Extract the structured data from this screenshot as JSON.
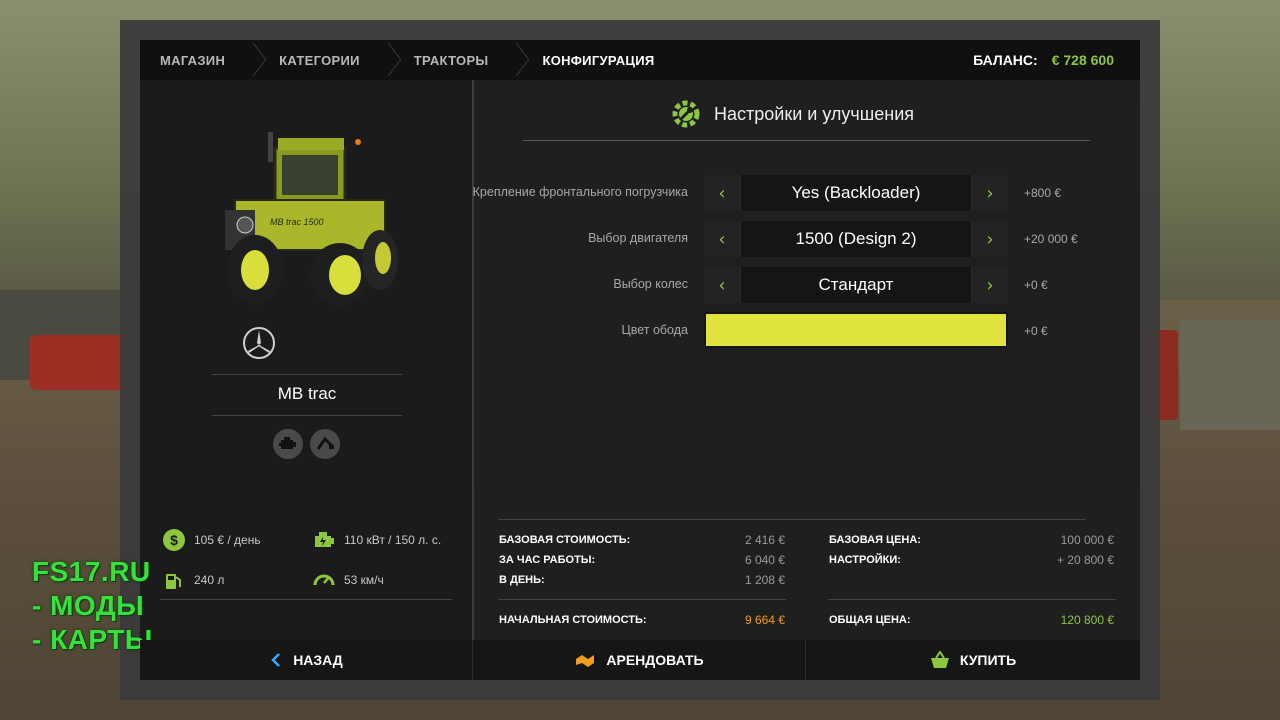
{
  "breadcrumb": [
    "МАГАЗИН",
    "КАТЕГОРИИ",
    "ТРАКТОРЫ",
    "КОНФИГУРАЦИЯ"
  ],
  "balance": {
    "label": "БАЛАНС:",
    "value": "€ 728 600"
  },
  "vehicle": {
    "model": "MB trac",
    "brand_logo": "mercedes-benz-star-icon"
  },
  "specs": {
    "daily_cost": "105 € / день",
    "power": "110 кВт / 150 л. с.",
    "fuel": "240 л",
    "speed": "53 км/ч"
  },
  "section_title": "Настройки и улучшения",
  "options": [
    {
      "label": "Крепление фронтального погрузчика",
      "value": "Yes (Backloader)",
      "price": "+800 €"
    },
    {
      "label": "Выбор двигателя",
      "value": "1500 (Design 2)",
      "price": "+20 000 €"
    },
    {
      "label": "Выбор колес",
      "value": "Стандарт",
      "price": "+0 €"
    },
    {
      "label": "Цвет обода",
      "color": "#dfe33c",
      "price": "+0 €"
    }
  ],
  "costs": {
    "base_cost_label": "БАЗОВАЯ СТОИМОСТЬ:",
    "base_cost": "2 416 €",
    "per_hour_label": "ЗА ЧАС РАБОТЫ:",
    "per_hour": "6 040 €",
    "per_day_label": "В ДЕНЬ:",
    "per_day": "1 208 €",
    "initial_label": "НАЧАЛЬНАЯ СТОИМОСТЬ:",
    "initial": "9 664 €",
    "base_price_label": "БАЗОВАЯ ЦЕНА:",
    "base_price": "100 000 €",
    "config_label": "НАСТРОЙКИ:",
    "config": "+ 20 800 €",
    "total_label": "ОБЩАЯ ЦЕНА:",
    "total": "120 800 €"
  },
  "buttons": {
    "back": "НАЗАД",
    "lease": "АРЕНДОВАТЬ",
    "buy": "КУПИТЬ"
  },
  "watermark": [
    "FS17.RU",
    "- МОДЫ",
    "- КАРТЫ"
  ],
  "colors": {
    "accent_green": "#8dc63f",
    "orange": "#f39c23",
    "rim_color": "#dfe33c",
    "watermark_green": "#35e13a"
  }
}
